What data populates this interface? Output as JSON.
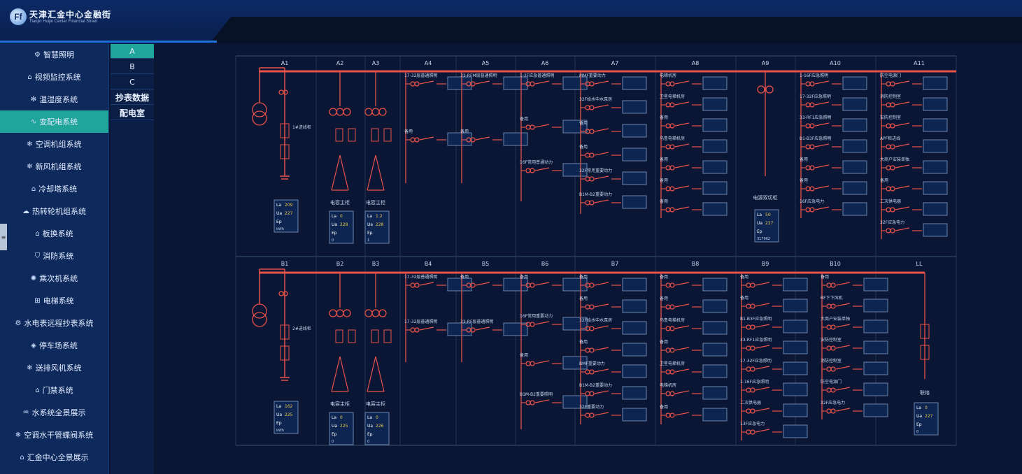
{
  "header": {
    "logo_text": "Ff",
    "title": "天津汇金中心金融街",
    "subtitle": "Tianjin Huijin Center Financial Street"
  },
  "sidebar": {
    "items": [
      {
        "icon": "gear-icon",
        "glyph": "⚙",
        "label": "智慧照明"
      },
      {
        "icon": "home-icon",
        "glyph": "⌂",
        "label": "视频监控系统"
      },
      {
        "icon": "sun-icon",
        "glyph": "✻",
        "label": "温湿度系统"
      },
      {
        "icon": "pulse-icon",
        "glyph": "∿",
        "label": "变配电系统",
        "active": true
      },
      {
        "icon": "snow-icon",
        "glyph": "❄",
        "label": "空调机组系统"
      },
      {
        "icon": "snow-icon",
        "glyph": "❄",
        "label": "新风机组系统"
      },
      {
        "icon": "home-icon",
        "glyph": "⌂",
        "label": "冷却塔系统"
      },
      {
        "icon": "cloud-icon",
        "glyph": "☁",
        "label": "热转轮机组系统"
      },
      {
        "icon": "home-icon",
        "glyph": "⌂",
        "label": "板换系统"
      },
      {
        "icon": "shield-icon",
        "glyph": "⛉",
        "label": "消防系统"
      },
      {
        "icon": "fan-icon",
        "glyph": "✺",
        "label": "乘次机系统"
      },
      {
        "icon": "elevator-icon",
        "glyph": "⊞",
        "label": "电梯系统"
      },
      {
        "icon": "meter-icon",
        "glyph": "⚙",
        "label": "水电表远程抄表系统"
      },
      {
        "icon": "tag-icon",
        "glyph": "◈",
        "label": "停车场系统"
      },
      {
        "icon": "snow-icon",
        "glyph": "❄",
        "label": "送排风机系统"
      },
      {
        "icon": "home-icon",
        "glyph": "⌂",
        "label": "门禁系统"
      },
      {
        "icon": "water-icon",
        "glyph": "♒",
        "label": "水系统全景展示"
      },
      {
        "icon": "snow-icon",
        "glyph": "❄",
        "label": "空调水干管蝶阀系统"
      },
      {
        "icon": "home-icon",
        "glyph": "⌂",
        "label": "汇金中心全景展示"
      }
    ]
  },
  "submenu": {
    "items": [
      {
        "label": "A",
        "active": true
      },
      {
        "label": "B"
      },
      {
        "label": "C"
      },
      {
        "label": "抄表数据",
        "bold": true
      },
      {
        "label": "配电室",
        "bold": true
      }
    ]
  },
  "diagram": {
    "colors": {
      "line": "#e8524a",
      "grid": "#3a4e6e",
      "text": "#c8d6ee",
      "box_bg": "#0d2550",
      "box_border": "#6a86b0",
      "val_yellow": "#e8c84a",
      "val_green": "#4ad86a"
    },
    "top_row": {
      "headers": [
        "A1",
        "A2",
        "A3",
        "A4",
        "A5",
        "A6",
        "A7",
        "A8",
        "A9",
        "A10",
        "A11"
      ],
      "a1_label": "1#进线柜",
      "a2_label": "电容主柜",
      "a3_label": "电容主柜",
      "a9_label": "电源双切柜",
      "a1_box": {
        "la": "209",
        "ua": "227",
        "ep": "kWh"
      },
      "a2_box": {
        "la": "0",
        "ua": "228",
        "ep": "0"
      },
      "a3_box": {
        "la": "1.2",
        "ua": "228",
        "ep": "1"
      },
      "a9_box": {
        "la": "50",
        "ua": "227",
        "ep": "317962"
      },
      "a4_labels": [
        "17-32层普通照明",
        "备用"
      ],
      "a5_labels": [
        "33-RFM层普通照明",
        "备用"
      ],
      "a6_labels": [
        "1-2F应急普通照明",
        "备用",
        "16F常用普通动力"
      ],
      "a7_labels": [
        "MMF重要动力",
        "32F给水中水泵房",
        "备用",
        "备用",
        "32F常用重要动力",
        "B1M-B2重要动力"
      ],
      "a8_labels": [
        "电梯机房",
        "卫星电梯机房",
        "备用",
        "乌鲁电梯机房",
        "备用",
        "备用",
        "备用"
      ],
      "a10_labels": [
        "1-16F应急照明",
        "17-32F应急照明",
        "33-RF1应急照明",
        "B1-B3F应急照明",
        "备用",
        "备用",
        "16F应急电力"
      ],
      "a11_labels": [
        "防空电源门",
        "消防控制室",
        "安防控制室",
        "APF柜进线",
        "大商户安装单独",
        "备用",
        "二次供电器",
        "32F应急电力"
      ]
    },
    "bottom_row": {
      "headers": [
        "B1",
        "B2",
        "B3",
        "B4",
        "B5",
        "B6",
        "B7",
        "B8",
        "B9",
        "B10",
        "LL"
      ],
      "b1_label": "2#进线柜",
      "b2_label": "电容主柜",
      "b3_label": "电容主柜",
      "ll_label": "联络",
      "b1_box": {
        "la": "162",
        "ua": "225",
        "ep": "kWh"
      },
      "b2_box": {
        "la": "0",
        "ua": "225",
        "ep": "0"
      },
      "b3_box": {
        "la": "0",
        "ua": "226",
        "ep": "0"
      },
      "ll_box": {
        "la": "0",
        "ua": "227",
        "ep": "0"
      },
      "b4_labels": [
        "17-32层普通照明",
        "17-32层普通照明"
      ],
      "b5_labels": [
        "备用",
        "33-RF层普通照明"
      ],
      "b6_labels": [
        "备用",
        "16F常用重要动力",
        "备用",
        "B1M-B2重要照明"
      ],
      "b7_labels": [
        "备用",
        "备用",
        "32F给水中水泵房",
        "备用",
        "BMF重要动力",
        "B1M-B2重要动力",
        "32F重要动力"
      ],
      "b8_labels": [
        "备用",
        "备用",
        "乌鲁电梯机房",
        "备用",
        "卫星电梯机房",
        "电梯机房",
        "备用"
      ],
      "b9_labels": [
        "备用",
        "备用",
        "B1-B3F应急照明",
        "33-RF1应急照明",
        "17-32F应急照明",
        "1-16F应急照明",
        "二次供电器",
        "13F应急电力"
      ],
      "b10_labels": [
        "备用",
        "BF下下风机",
        "大商户安装单独",
        "安防控制室",
        "消防控制室",
        "防空电源门",
        "32F应急电力"
      ]
    }
  }
}
